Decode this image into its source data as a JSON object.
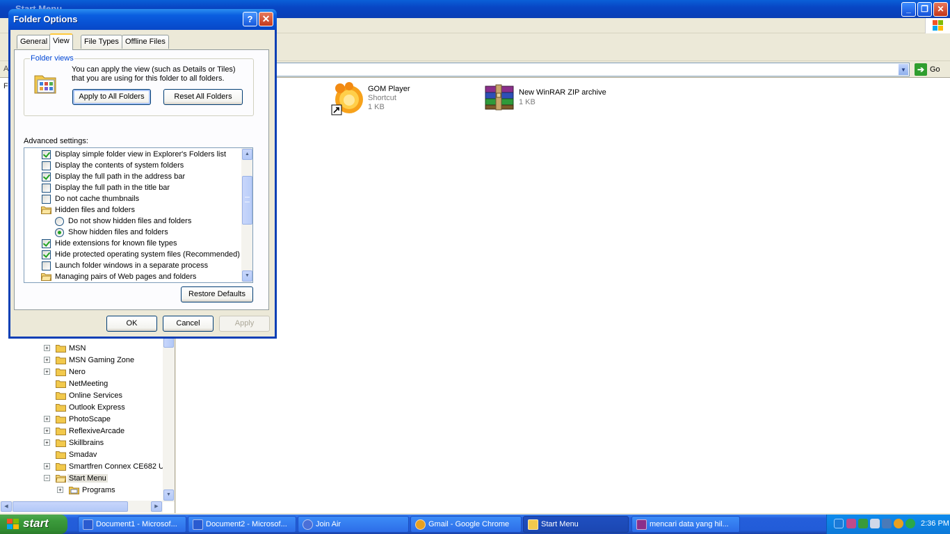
{
  "explorer": {
    "title": "Start Menu",
    "address_label": "A",
    "go_label": "Go",
    "left_edge_text": "F",
    "tree": [
      {
        "label": "MSN",
        "expandable": true
      },
      {
        "label": "MSN Gaming Zone",
        "expandable": true
      },
      {
        "label": "Nero",
        "expandable": true
      },
      {
        "label": "NetMeeting",
        "expandable": false
      },
      {
        "label": "Online Services",
        "expandable": false
      },
      {
        "label": "Outlook Express",
        "expandable": false
      },
      {
        "label": "PhotoScape",
        "expandable": true
      },
      {
        "label": "ReflexiveArcade",
        "expandable": true
      },
      {
        "label": "Skillbrains",
        "expandable": true
      },
      {
        "label": "Smadav",
        "expandable": false
      },
      {
        "label": "Smartfren Connex CE682 U",
        "expandable": true
      },
      {
        "label": "Start Menu",
        "expandable": true,
        "expanded": true,
        "selected": true
      },
      {
        "label": "Programs",
        "expandable": true,
        "child": true
      }
    ],
    "files": [
      {
        "name": "GOM Player",
        "type": "Shortcut",
        "size": "1 KB",
        "icon": "gom-player-icon"
      },
      {
        "name": "New WinRAR ZIP archive",
        "type": "",
        "size": "1 KB",
        "icon": "winrar-archive-icon"
      }
    ]
  },
  "dialog": {
    "title": "Folder Options",
    "help_label": "?",
    "close_label": "✕",
    "tabs": [
      "General",
      "View",
      "File Types",
      "Offline Files"
    ],
    "active_tab": "View",
    "folder_views": {
      "legend": "Folder views",
      "description": "You can apply the view (such as Details or Tiles) that you are using for this folder to all folders.",
      "apply_all": "Apply to All Folders",
      "reset_all": "Reset All Folders"
    },
    "advanced_label": "Advanced settings:",
    "advanced": [
      {
        "kind": "checkbox",
        "checked": true,
        "label": "Display simple folder view in Explorer's Folders list"
      },
      {
        "kind": "checkbox",
        "checked": false,
        "label": "Display the contents of system folders"
      },
      {
        "kind": "checkbox",
        "checked": true,
        "label": "Display the full path in the address bar"
      },
      {
        "kind": "checkbox",
        "checked": false,
        "label": "Display the full path in the title bar"
      },
      {
        "kind": "checkbox",
        "checked": false,
        "label": "Do not cache thumbnails"
      },
      {
        "kind": "folder",
        "label": "Hidden files and folders"
      },
      {
        "kind": "radio",
        "checked": false,
        "label": "Do not show hidden files and folders"
      },
      {
        "kind": "radio",
        "checked": true,
        "label": "Show hidden files and folders"
      },
      {
        "kind": "checkbox",
        "checked": true,
        "label": "Hide extensions for known file types"
      },
      {
        "kind": "checkbox",
        "checked": true,
        "label": "Hide protected operating system files (Recommended)"
      },
      {
        "kind": "checkbox",
        "checked": false,
        "label": "Launch folder windows in a separate process"
      },
      {
        "kind": "folder",
        "label": "Managing pairs of Web pages and folders"
      }
    ],
    "restore_defaults": "Restore Defaults",
    "ok": "OK",
    "cancel": "Cancel",
    "apply": "Apply"
  },
  "taskbar": {
    "start_label": "start",
    "tasks": [
      {
        "label": "Document1 - Microsof...",
        "icon": "word-icon",
        "active": false
      },
      {
        "label": "Document2 - Microsof...",
        "icon": "word-icon",
        "active": false
      },
      {
        "label": "Join Air",
        "icon": "join-air-icon",
        "active": false
      },
      {
        "label": "Gmail - Google Chrome",
        "icon": "chrome-icon",
        "active": false
      },
      {
        "label": "Start Menu",
        "icon": "folder-icon",
        "active": true
      },
      {
        "label": "mencari data yang hil...",
        "icon": "winrar-icon",
        "active": false
      }
    ],
    "clock": "2:36 PM"
  },
  "colors": {
    "xp_blue": "#0a5fd8",
    "start_green": "#3c9b3c",
    "check_green": "#21a121",
    "tab_highlight": "#ffc83c"
  }
}
